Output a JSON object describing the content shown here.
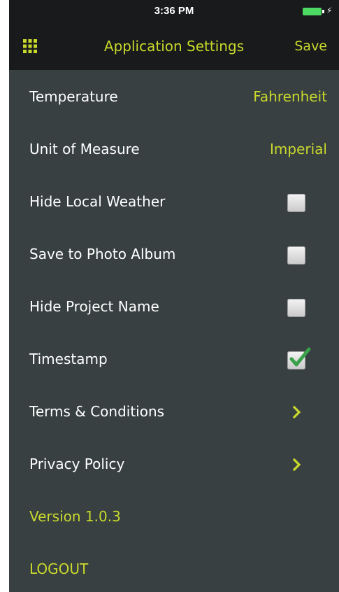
{
  "status_bar": {
    "time": "3:36 PM",
    "battery_color": "#4cd964"
  },
  "nav": {
    "menu_icon": "grid-icon",
    "title": "Application Settings",
    "save_label": "Save",
    "accent_color": "#c9d92c"
  },
  "settings": {
    "temperature": {
      "label": "Temperature",
      "value": "Fahrenheit"
    },
    "unit_of_measure": {
      "label": "Unit of Measure",
      "value": "Imperial"
    },
    "hide_local_weather": {
      "label": "Hide Local Weather",
      "checked": false
    },
    "save_to_photo_album": {
      "label": "Save to Photo Album",
      "checked": false
    },
    "hide_project_name": {
      "label": "Hide Project Name",
      "checked": false
    },
    "timestamp": {
      "label": "Timestamp",
      "checked": true
    },
    "terms": {
      "label": "Terms & Conditions",
      "icon": "chevron-right-icon"
    },
    "privacy": {
      "label": "Privacy Policy",
      "icon": "chevron-right-icon"
    },
    "version": {
      "label": "Version 1.0.3"
    },
    "logout": {
      "label": "LOGOUT"
    }
  }
}
